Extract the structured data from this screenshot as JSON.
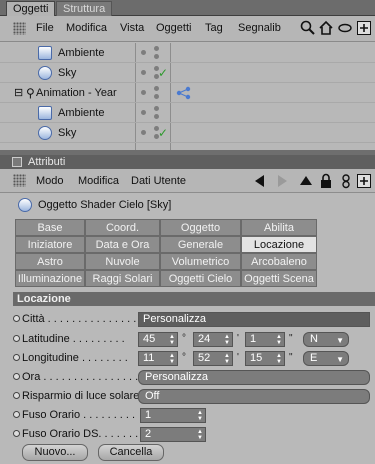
{
  "tabs": {
    "active": "Oggetti",
    "inactive": "Struttura"
  },
  "menubar": {
    "items": [
      "File",
      "Modifica",
      "Vista",
      "Oggetti",
      "Tag",
      "Segnalib"
    ]
  },
  "tree": {
    "rows": [
      {
        "label": "Ambiente"
      },
      {
        "label": "Sky"
      },
      {
        "label": "Animation - Year"
      },
      {
        "label": "Ambiente"
      },
      {
        "label": "Sky"
      }
    ]
  },
  "attributes": {
    "title": "Attributi",
    "menu": [
      "Modo",
      "Modifica",
      "Dati Utente"
    ],
    "object_title": "Oggetto Shader Cielo [Sky]"
  },
  "tabgrid": {
    "row1": [
      "Base",
      "Coord.",
      "Oggetto",
      "Abilita"
    ],
    "row2": [
      "Iniziatore",
      "Data e Ora",
      "Generale",
      "Locazione"
    ],
    "row3": [
      "Astro",
      "Nuvole",
      "Volumetrico",
      "Arcobaleno"
    ],
    "row4": [
      "Illuminazione",
      "Raggi Solari",
      "Oggetti Cielo",
      "Oggetti Scena"
    ],
    "active": "Locazione"
  },
  "section": {
    "title": "Locazione"
  },
  "fields": {
    "citta": {
      "label": "Città . . . . . . . . . . . . . . .",
      "value": "Personalizza"
    },
    "latitudine": {
      "label": "Latitudine . . . . . . . . .",
      "deg": "45",
      "min": "24",
      "sec": "1",
      "dir": "N"
    },
    "longitudine": {
      "label": "Longitudine . . . . . . . .",
      "deg": "11",
      "min": "52",
      "sec": "15",
      "dir": "E"
    },
    "ora": {
      "label": "Ora . . . . . . . . . . . . . . . .",
      "value": "Personalizza"
    },
    "risparmio": {
      "label": "Risparmio di luce solare",
      "value": "Off"
    },
    "fuso": {
      "label": "Fuso Orario . . . . . . . . .",
      "value": "1"
    },
    "fuso_ds": {
      "label": "Fuso Orario DS. . . . . . .",
      "value": "2"
    }
  },
  "buttons": {
    "nuovo": "Nuovo...",
    "cancella": "Cancella"
  },
  "symbols": {
    "deg": "°",
    "min": "'",
    "sec": "\""
  }
}
